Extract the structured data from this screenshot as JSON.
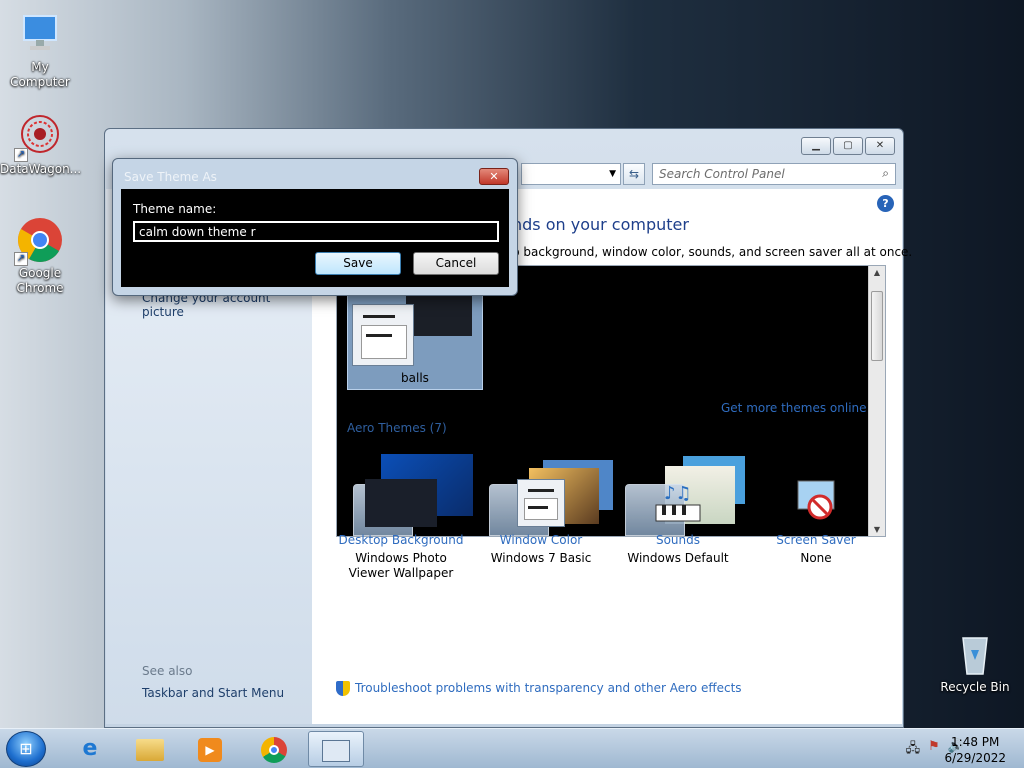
{
  "desktop": {
    "icons": [
      {
        "label": "My Computer"
      },
      {
        "label": "DataWagon..."
      },
      {
        "label": "Google Chrome"
      },
      {
        "label": "Recycle Bin"
      }
    ]
  },
  "control_panel": {
    "search_placeholder": "Search Control Panel",
    "left_link": "Change your account picture",
    "see_also": "See also",
    "taskbar_link": "Taskbar and Start Menu",
    "main_title": "nds on your computer",
    "main_subtitle": "p background, window color, sounds, and screen saver all at once.",
    "my_theme_label": "balls",
    "get_more_link": "Get more themes online",
    "aero_header": "Aero Themes (7)",
    "bottom_items": [
      {
        "link": "Desktop Background",
        "value": "Windows Photo Viewer Wallpaper"
      },
      {
        "link": "Window Color",
        "value": "Windows 7 Basic"
      },
      {
        "link": "Sounds",
        "value": "Windows Default"
      },
      {
        "link": "Screen Saver",
        "value": "None"
      }
    ],
    "troubleshoot_link": "Troubleshoot problems with transparency and other Aero effects"
  },
  "dialog": {
    "title": "Save Theme As",
    "label": "Theme name:",
    "input_value": "calm down theme r",
    "save_label": "Save",
    "cancel_label": "Cancel"
  },
  "taskbar": {
    "time": "1:48 PM",
    "date": "6/29/2022"
  }
}
